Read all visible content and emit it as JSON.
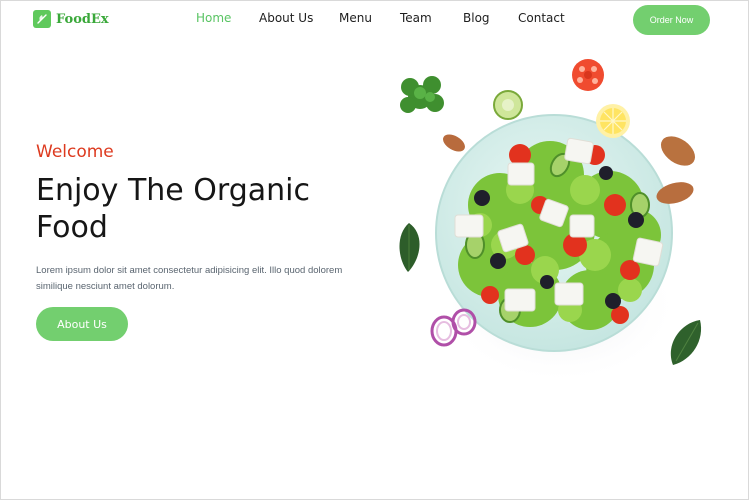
{
  "brand": {
    "name": "FoodEx",
    "logo_icon": "leaf-logo-icon",
    "color": "#59c463"
  },
  "nav": {
    "items": [
      {
        "label": "Home",
        "active": true
      },
      {
        "label": "About Us",
        "active": false
      },
      {
        "label": "Menu",
        "active": false
      },
      {
        "label": "Team",
        "active": false
      },
      {
        "label": "Blog",
        "active": false
      },
      {
        "label": "Contact",
        "active": false
      }
    ],
    "cta_label": "Order Now"
  },
  "hero": {
    "eyebrow": "Welcome",
    "title": "Enjoy The Organic Food",
    "description": "Lorem ipsum dolor sit amet consectetur adipisicing elit.  Illo quod dolorem similique nesciunt amet dolorum.",
    "button_label": "About Us",
    "image": "salad-bowl-illustration"
  },
  "colors": {
    "accent": "#73cf6f",
    "eyebrow": "#dd3a1f",
    "text": "#161616"
  }
}
